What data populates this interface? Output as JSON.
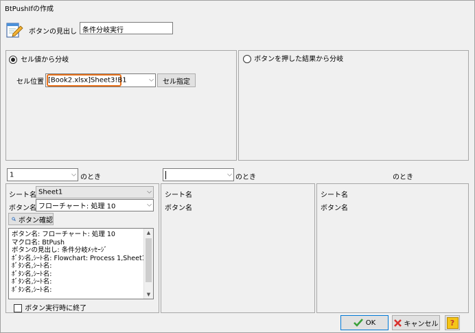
{
  "window": {
    "title": "BtPushIfの作成"
  },
  "header": {
    "heading_label": "ボタンの見出し",
    "heading_value": "条件分岐実行"
  },
  "branch_cell": {
    "radio_label": "セル値から分岐",
    "cell_position_label": "セル位置",
    "cell_position_value": "[Book2.xlsx]Sheet3!B1",
    "cell_select_button": "セル指定"
  },
  "branch_button": {
    "radio_label": "ボタンを押した結果から分岐"
  },
  "conditions": {
    "col1_value": "1",
    "col2_value": "",
    "when_label_1": "のとき",
    "when_label_2": "のとき",
    "when_label_3": "のとき"
  },
  "column1": {
    "sheet_label": "シート名",
    "sheet_value": "Sheet1",
    "button_label": "ボタン名",
    "button_value": "フローチャート: 処理 10",
    "confirm_button": "ボタン確認",
    "info_lines": [
      "ボタン名: フローチャート: 処理 10",
      "マクロ名: BtPush",
      " ボタンの見出し: 条件分岐ﾒｯｾｰｼﾞ",
      "ﾎﾞﾀﾝ名,ｼｰﾄ名: Flowchart: Process 1,Sheet1",
      "ﾎﾞﾀﾝ名,ｼｰﾄ名:",
      "ﾎﾞﾀﾝ名,ｼｰﾄ名:",
      "ﾎﾞﾀﾝ名,ｼｰﾄ名:",
      "ﾎﾞﾀﾝ名,ｼｰﾄ名:"
    ],
    "exit_checkbox_label": "ボタン実行時に終了"
  },
  "column2": {
    "sheet_label": "シート名",
    "button_label": "ボタン名"
  },
  "column3": {
    "sheet_label": "シート名",
    "button_label": "ボタン名"
  },
  "footer": {
    "ok_label": "OK",
    "cancel_label": "キャンセル",
    "help_label": "?"
  },
  "colors": {
    "highlight_border": "#e8721c",
    "ok_check": "#3aa03a",
    "cancel_x": "#d9302c",
    "help_bg": "#f5c518"
  }
}
